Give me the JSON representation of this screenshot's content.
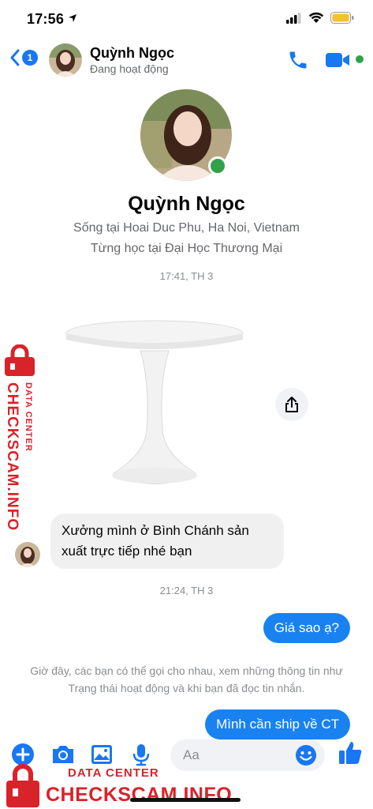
{
  "status_bar": {
    "time": "17:56"
  },
  "header": {
    "back_badge": "1",
    "name": "Quỳnh Ngọc",
    "status": "Đang hoạt động"
  },
  "profile": {
    "name": "Quỳnh Ngọc",
    "lives_in": "Sống tại Hoai Duc Phu, Ha Noi, Vietnam",
    "studied_at": "Từng học tại Đại Học Thương Mại"
  },
  "messages": {
    "timestamp_1": "17:41, TH 3",
    "incoming_text": "Xưởng mình ở Bình Chánh sản xuất trực tiếp nhé bạn",
    "timestamp_2": "21:24, TH 3",
    "outgoing_1": "Giá sao ạ?",
    "system_note": "Giờ đây, các bạn có thể gọi cho nhau, xem những thông tin như Trạng thái hoạt động và khi bạn đã đọc tin nhắn.",
    "outgoing_2": "Mình cần ship về CT"
  },
  "composer": {
    "placeholder": "Aa"
  },
  "watermark": {
    "data_center": "DATA CENTER",
    "brand": "CHECKSCAM.INFO"
  },
  "colors": {
    "accent": "#1877f2",
    "bubble_out": "#1a82f0",
    "bubble_in": "#f0f0f0",
    "online": "#31a24c",
    "watermark": "#d8232a"
  }
}
